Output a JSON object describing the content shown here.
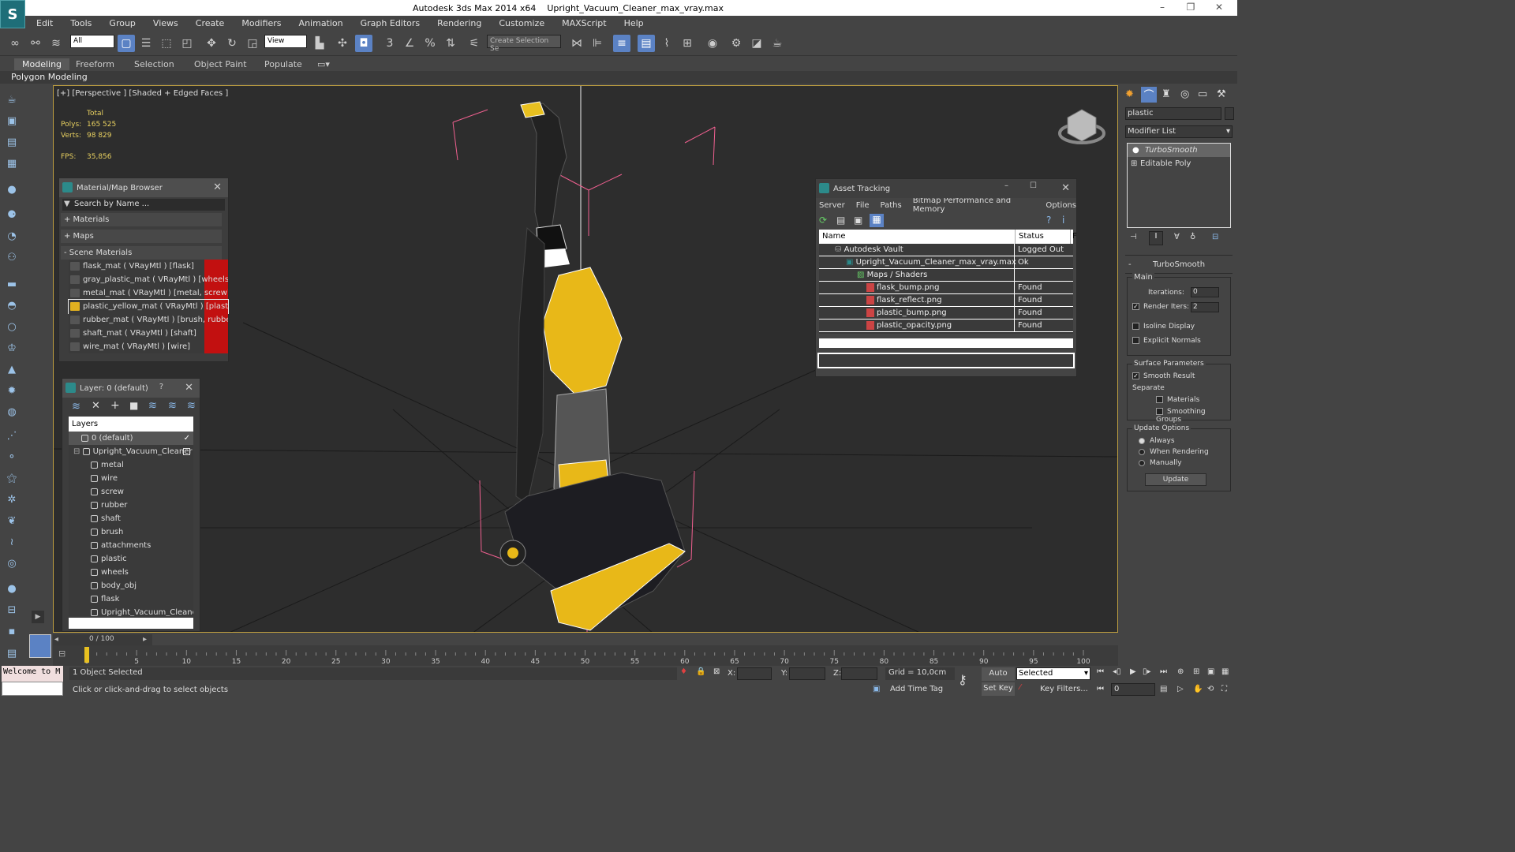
{
  "titlebar": {
    "app": "Autodesk 3ds Max  2014 x64",
    "file": "Upright_Vacuum_Cleaner_max_vray.max"
  },
  "menu": [
    "Edit",
    "Tools",
    "Group",
    "Views",
    "Create",
    "Modifiers",
    "Animation",
    "Graph Editors",
    "Rendering",
    "Customize",
    "MAXScript",
    "Help"
  ],
  "toolbar": {
    "filter": "All",
    "refcoord": "View",
    "selection_set": "Create Selection Se"
  },
  "ribbon": {
    "tabs": [
      "Modeling",
      "Freeform",
      "Selection",
      "Object Paint",
      "Populate"
    ],
    "sub": "Polygon Modeling"
  },
  "viewport": {
    "label": "[+] [Perspective ] [Shaded + Edged Faces ]",
    "stats": {
      "total": "Total",
      "polys_label": "Polys:",
      "polys": "165 525",
      "verts_label": "Verts:",
      "verts": "98 829",
      "fps_label": "FPS:",
      "fps": "35,856"
    }
  },
  "material_browser": {
    "title": "Material/Map Browser",
    "search": "Search by Name ...",
    "groups": [
      "+ Materials",
      "+ Maps",
      "- Scene Materials"
    ],
    "items": [
      "flask_mat  ( VRayMtl ) [flask]",
      "gray_plastic_mat  ( VRayMtl ) [wheels]",
      "metal_mat  ( VRayMtl ) [metal, screw]",
      "plastic_yellow_mat  ( VRayMtl ) [plastic]",
      "rubber_mat  ( VRayMtl ) [brush, rubber]",
      "shaft_mat  ( VRayMtl ) [shaft]",
      "wire_mat  ( VRayMtl ) [wire]"
    ]
  },
  "layers": {
    "title": "Layer: 0 (default)",
    "help": "?",
    "header": "Layers",
    "root": [
      "0 (default)",
      "Upright_Vacuum_Cleaner"
    ],
    "children": [
      "metal",
      "wire",
      "screw",
      "rubber",
      "shaft",
      "brush",
      "attachments",
      "plastic",
      "wheels",
      "body_obj",
      "flask",
      "Upright_Vacuum_Cleaner"
    ]
  },
  "asset_tracking": {
    "title": "Asset Tracking",
    "menu": [
      "Server",
      "File",
      "Paths",
      "Bitmap Performance and Memory",
      "Options"
    ],
    "columns": [
      "Name",
      "Status",
      "F"
    ],
    "rows": [
      {
        "name": "Autodesk Vault",
        "status": "Logged Out ..."
      },
      {
        "name": "Upright_Vacuum_Cleaner_max_vray.max",
        "status": "Ok"
      },
      {
        "name": "Maps / Shaders",
        "status": ""
      },
      {
        "name": "flask_bump.png",
        "status": "Found"
      },
      {
        "name": "flask_reflect.png",
        "status": "Found"
      },
      {
        "name": "plastic_bump.png",
        "status": "Found"
      },
      {
        "name": "plastic_opacity.png",
        "status": "Found"
      }
    ]
  },
  "command_panel": {
    "object_name": "plastic",
    "modifier_list": "Modifier List",
    "stack": [
      "TurboSmooth",
      "Editable Poly"
    ],
    "rollout": "TurboSmooth",
    "main": "Main",
    "iterations_label": "Iterations:",
    "iterations": "0",
    "render_iters_label": "Render Iters:",
    "render_iters": "2",
    "isoline": "Isoline Display",
    "explicit": "Explicit Normals",
    "surface": "Surface Parameters",
    "smooth_result": "Smooth Result",
    "separate": "Separate",
    "materials": "Materials",
    "smoothing_groups": "Smoothing Groups",
    "update_options": "Update Options",
    "always": "Always",
    "when_rendering": "When Rendering",
    "manually": "Manually",
    "update": "Update"
  },
  "timeline": {
    "frame": "0 / 100",
    "ticks": [
      "0",
      "5",
      "10",
      "15",
      "20",
      "25",
      "30",
      "35",
      "40",
      "45",
      "50",
      "55",
      "60",
      "65",
      "70",
      "75",
      "80",
      "85",
      "90",
      "95",
      "100"
    ]
  },
  "status": {
    "maxscript": "Welcome to M",
    "selected": "1 Object Selected",
    "prompt": "Click or click-and-drag to select objects",
    "x": "X:",
    "y": "Y:",
    "z": "Z:",
    "grid": "Grid = 10,0cm",
    "add_time_tag": "Add Time Tag",
    "auto_key": "Auto Key",
    "set_key": "Set Key",
    "key_mode": "Selected",
    "key_filters": "Key Filters...",
    "frame": "0"
  }
}
